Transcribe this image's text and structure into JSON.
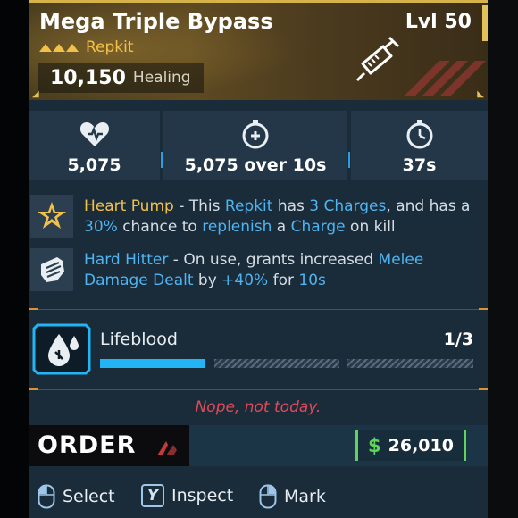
{
  "item": {
    "title": "Mega Triple Bypass",
    "level": "Lvl 50",
    "rarity": "Repkit",
    "stat_value": "10,150",
    "stat_unit": "Healing",
    "icon": "syringe-icon"
  },
  "stats": [
    {
      "icon": "heart-health-icon",
      "value": "5,075"
    },
    {
      "icon": "timer-heal-icon",
      "value": "5,075 over 10s"
    },
    {
      "icon": "cooldown-timer-icon",
      "value": "37s"
    }
  ],
  "perks": [
    {
      "icon": "star-badge-icon",
      "name": "Heart Pump",
      "t1": " - This ",
      "k1": "Repkit",
      "t2": " has ",
      "k2": "3 Charges",
      "t3": ", and has a ",
      "k3": "30%",
      "t4": " chance to ",
      "k4": "replenish",
      "t5": " a ",
      "k5": "Charge",
      "t6": " on kill"
    },
    {
      "icon": "fist-icon",
      "name": "Hard Hitter",
      "t1": " - On use, grants increased ",
      "k1": "Melee Damage Dealt",
      "t2": " by ",
      "k2": "+40%",
      "t3": " for ",
      "k3": "10s"
    }
  ],
  "lifeblood": {
    "name": "Lifeblood",
    "count": "1/3",
    "progress": 0.333,
    "icon": "blood-drop-icon"
  },
  "warning": "Nope, not today.",
  "manufacturer": {
    "logo_text": "ORDER"
  },
  "price": {
    "currency": "$",
    "value": "26,010"
  },
  "controls": [
    {
      "icon": "mouse-left-icon",
      "label": "Select"
    },
    {
      "key": "Y",
      "label": "Inspect"
    },
    {
      "icon": "mouse-right-icon",
      "label": "Mark"
    }
  ],
  "colors": {
    "rarity_gold": "#f2c14a",
    "keyword_blue": "#4fb4f0",
    "warning_red": "#e04a58",
    "price_green": "#5fd45c",
    "progress_blue": "#22b4f4"
  }
}
